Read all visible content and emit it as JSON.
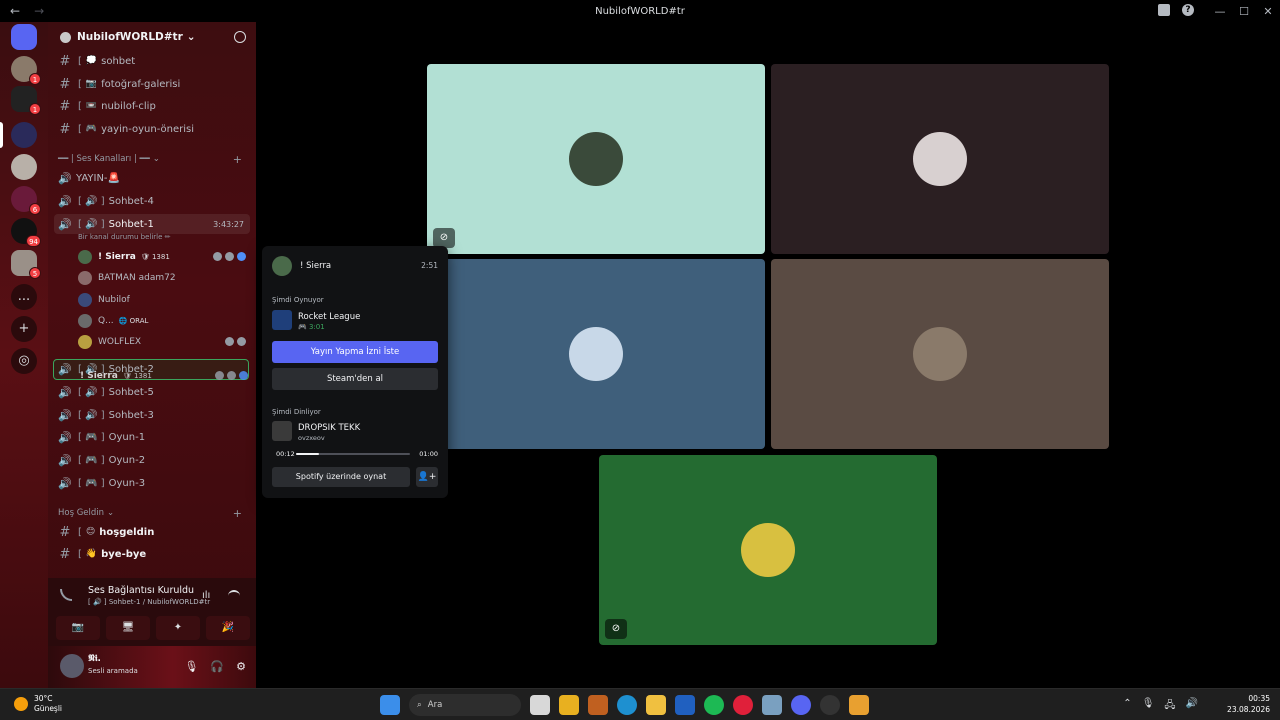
{
  "window": {
    "title": "NubilofWORLD#tr",
    "nav_back": "←",
    "nav_forward": "→",
    "help": "?",
    "minimize": "—",
    "maximize": "☐",
    "close": "✕"
  },
  "rail": {
    "servers": [
      {
        "badge": "1"
      },
      {
        "badge": "1"
      },
      {
        "badge": ""
      },
      {
        "badge": ""
      },
      {
        "badge": "6"
      },
      {
        "badge": "94"
      },
      {
        "badge": "5"
      }
    ],
    "more": "...",
    "add": "+",
    "discover": "◎"
  },
  "sidebar": {
    "guild_name": "NubilofWORLD#tr",
    "text_channels": [
      {
        "emoji": "💭",
        "name": "sohbet"
      },
      {
        "emoji": "📷",
        "name": "fotoğraf-galerisi"
      },
      {
        "emoji": "📼",
        "name": "nubilof-clip"
      },
      {
        "emoji": "🎮",
        "name": "yayin-oyun-önerisi"
      }
    ],
    "voice_category": "━━ | Ses Kanalları | ━━",
    "voice_channels": {
      "yayin": "YAYIN-🚨",
      "sohbet4": "Sohbet-4",
      "sohbet1": "Sohbet-1",
      "sohbet1_time": "3:43:27",
      "sohbet1_status": "Bir kanal durumu belirle ✏",
      "sohbet2": "Sohbet-2",
      "sohbet5": "Sohbet-5",
      "sohbet3": "Sohbet-3",
      "oyun1": "Oyun-1",
      "oyun2": "Oyun-2",
      "oyun3": "Oyun-3"
    },
    "members": [
      {
        "name": "! Sierra",
        "tag": "🛡 1381"
      },
      {
        "name": "BATMAN adam72",
        "tag": ""
      },
      {
        "name": "Nubilof",
        "tag": ""
      },
      {
        "name": "Q...",
        "tag": "🌐 ORAL"
      },
      {
        "name": "WOLFLEX",
        "tag": ""
      }
    ],
    "drag_ghost": {
      "name": "! Sierra",
      "tag": "🛡 1381"
    },
    "welcome_category": "Hoş Geldin",
    "welcome_channels": [
      {
        "emoji": "😊",
        "name": "hoşgeldin"
      },
      {
        "emoji": "👋",
        "name": "bye-bye"
      }
    ]
  },
  "voice_panel": {
    "status": "Ses Bağlantısı Kuruldu",
    "channel": "[ 🔊 ] Sohbet-1 / NubilofWORLD#tr",
    "buttons": [
      "📷",
      "🖥",
      "✦",
      "🎉"
    ],
    "user_name": "𝕹𝖎.",
    "user_status": "Sesli aramada",
    "mic": "🎙",
    "headphones": "🎧",
    "settings": "⚙"
  },
  "popout": {
    "user_name": "! Sierra",
    "time": "2:51",
    "playing_label": "Şimdi Oynuyor",
    "game_name": "Rocket League",
    "game_time": "🎮 3:01",
    "primary_button": "Yayın Yapma İzni İste",
    "secondary_button": "Steam'den al",
    "listening_label": "Şimdi Dinliyor",
    "song": "DROPSIK TEKK",
    "artist": "ovzxeov",
    "elapsed": "00:12",
    "total": "01:00",
    "progress": 0.2,
    "spotify_button": "Spotify üzerinde oynat",
    "friend_icon": "👤+"
  },
  "tiles": [
    {
      "bg": "#b2e0d4",
      "flagged": true,
      "flag_icon": "⊘"
    },
    {
      "bg": "#2b1f22",
      "flagged": false,
      "flag_icon": ""
    },
    {
      "bg": "#3f5f7b",
      "flagged": false,
      "flag_icon": ""
    },
    {
      "bg": "#5a4b43",
      "flagged": false,
      "flag_icon": ""
    },
    {
      "bg": "#246b31",
      "flagged": true,
      "flag_icon": "⊘"
    }
  ],
  "taskbar": {
    "temp": "30°C",
    "weather": "Güneşli",
    "search": "Ara",
    "time": "00:35",
    "date": "23.08.2026",
    "tray_up": "⌃",
    "tray_mic": "🎙",
    "tray_net": "🖧",
    "tray_vol": "🔊"
  }
}
